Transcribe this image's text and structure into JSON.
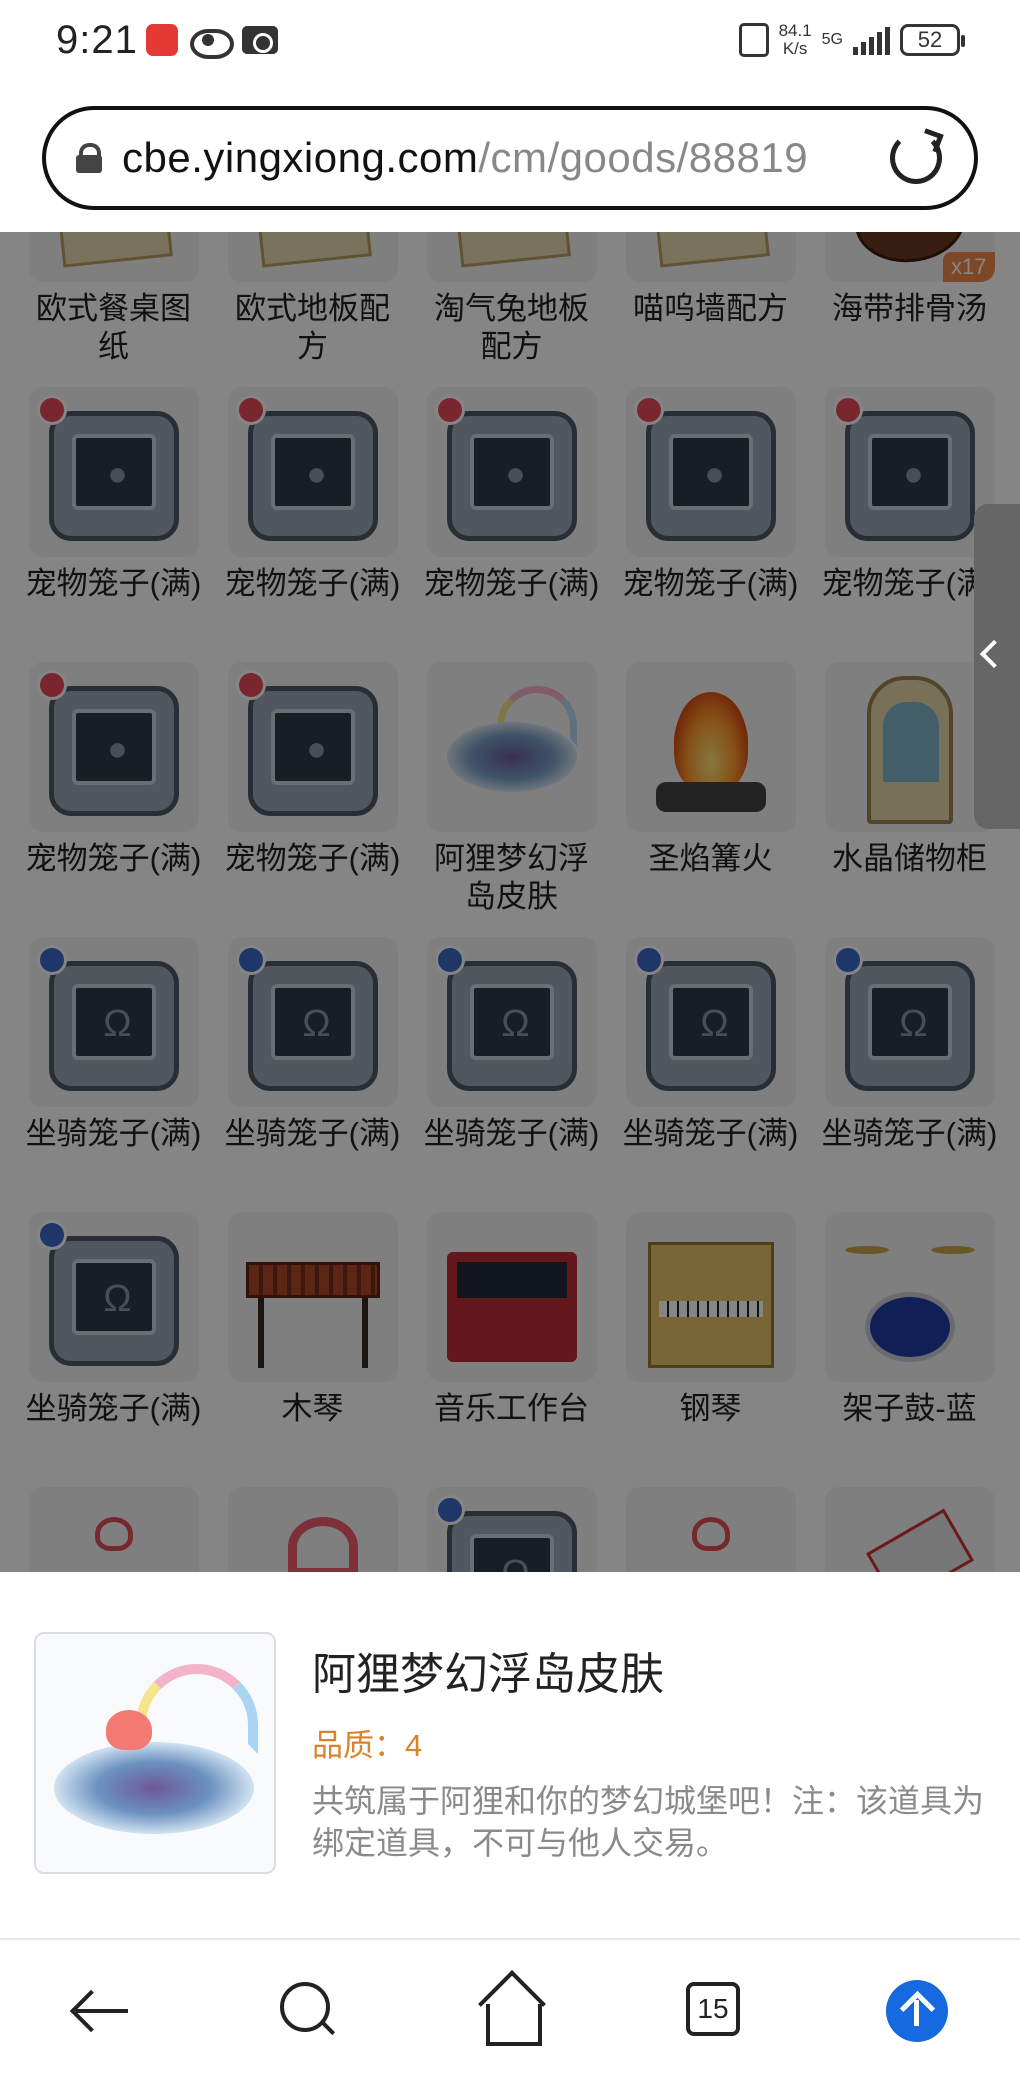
{
  "status_bar": {
    "time": "9:21",
    "net_speed_value": "84.1",
    "net_speed_unit": "K/s",
    "network": "5G",
    "battery": "52"
  },
  "browser": {
    "url_host": "cbe.yingxiong.com",
    "url_path": "/cm/goods/88819"
  },
  "items": [
    {
      "name": "欧式餐桌图纸",
      "art": "paper",
      "badge": ""
    },
    {
      "name": "欧式地板配方",
      "art": "paper",
      "badge": ""
    },
    {
      "name": "淘气兔地板配方",
      "art": "paper",
      "badge": ""
    },
    {
      "name": "喵呜墙配方",
      "art": "paper",
      "badge": ""
    },
    {
      "name": "海带排骨汤",
      "art": "soup",
      "badge": "x17"
    },
    {
      "name": "宠物笼子(满)",
      "art": "pet-cage",
      "badge": ""
    },
    {
      "name": "宠物笼子(满)",
      "art": "pet-cage",
      "badge": ""
    },
    {
      "name": "宠物笼子(满)",
      "art": "pet-cage",
      "badge": ""
    },
    {
      "name": "宠物笼子(满)",
      "art": "pet-cage",
      "badge": ""
    },
    {
      "name": "宠物笼子(满)",
      "art": "pet-cage",
      "badge": ""
    },
    {
      "name": "宠物笼子(满)",
      "art": "pet-cage",
      "badge": ""
    },
    {
      "name": "宠物笼子(满)",
      "art": "pet-cage",
      "badge": ""
    },
    {
      "name": "阿狸梦幻浮岛皮肤",
      "art": "island",
      "badge": ""
    },
    {
      "name": "圣焰篝火",
      "art": "bonfire",
      "badge": ""
    },
    {
      "name": "水晶储物柜",
      "art": "cabinet",
      "badge": ""
    },
    {
      "name": "坐骑笼子(满)",
      "art": "mount-cage",
      "badge": ""
    },
    {
      "name": "坐骑笼子(满)",
      "art": "mount-cage",
      "badge": ""
    },
    {
      "name": "坐骑笼子(满)",
      "art": "mount-cage",
      "badge": ""
    },
    {
      "name": "坐骑笼子(满)",
      "art": "mount-cage",
      "badge": ""
    },
    {
      "name": "坐骑笼子(满)",
      "art": "mount-cage",
      "badge": ""
    },
    {
      "name": "坐骑笼子(满)",
      "art": "mount-cage",
      "badge": ""
    },
    {
      "name": "木琴",
      "art": "xylophone",
      "badge": ""
    },
    {
      "name": "音乐工作台",
      "art": "studio",
      "badge": ""
    },
    {
      "name": "钢琴",
      "art": "piano",
      "badge": ""
    },
    {
      "name": "架子鼓-蓝",
      "art": "drum",
      "badge": ""
    },
    {
      "name": "",
      "art": "heart-stick",
      "badge": ""
    },
    {
      "name": "",
      "art": "pink-ear",
      "badge": ""
    },
    {
      "name": "",
      "art": "mount-cage",
      "badge": ""
    },
    {
      "name": "",
      "art": "heart-stick",
      "badge": ""
    },
    {
      "name": "",
      "art": "shoe",
      "badge": ""
    }
  ],
  "detail": {
    "title": "阿狸梦幻浮岛皮肤",
    "quality": "品质：4",
    "description": "共筑属于阿狸和你的梦幻城堡吧！注：该道具为绑定道具，不可与他人交易。"
  },
  "nav": {
    "tab_count": "15"
  }
}
